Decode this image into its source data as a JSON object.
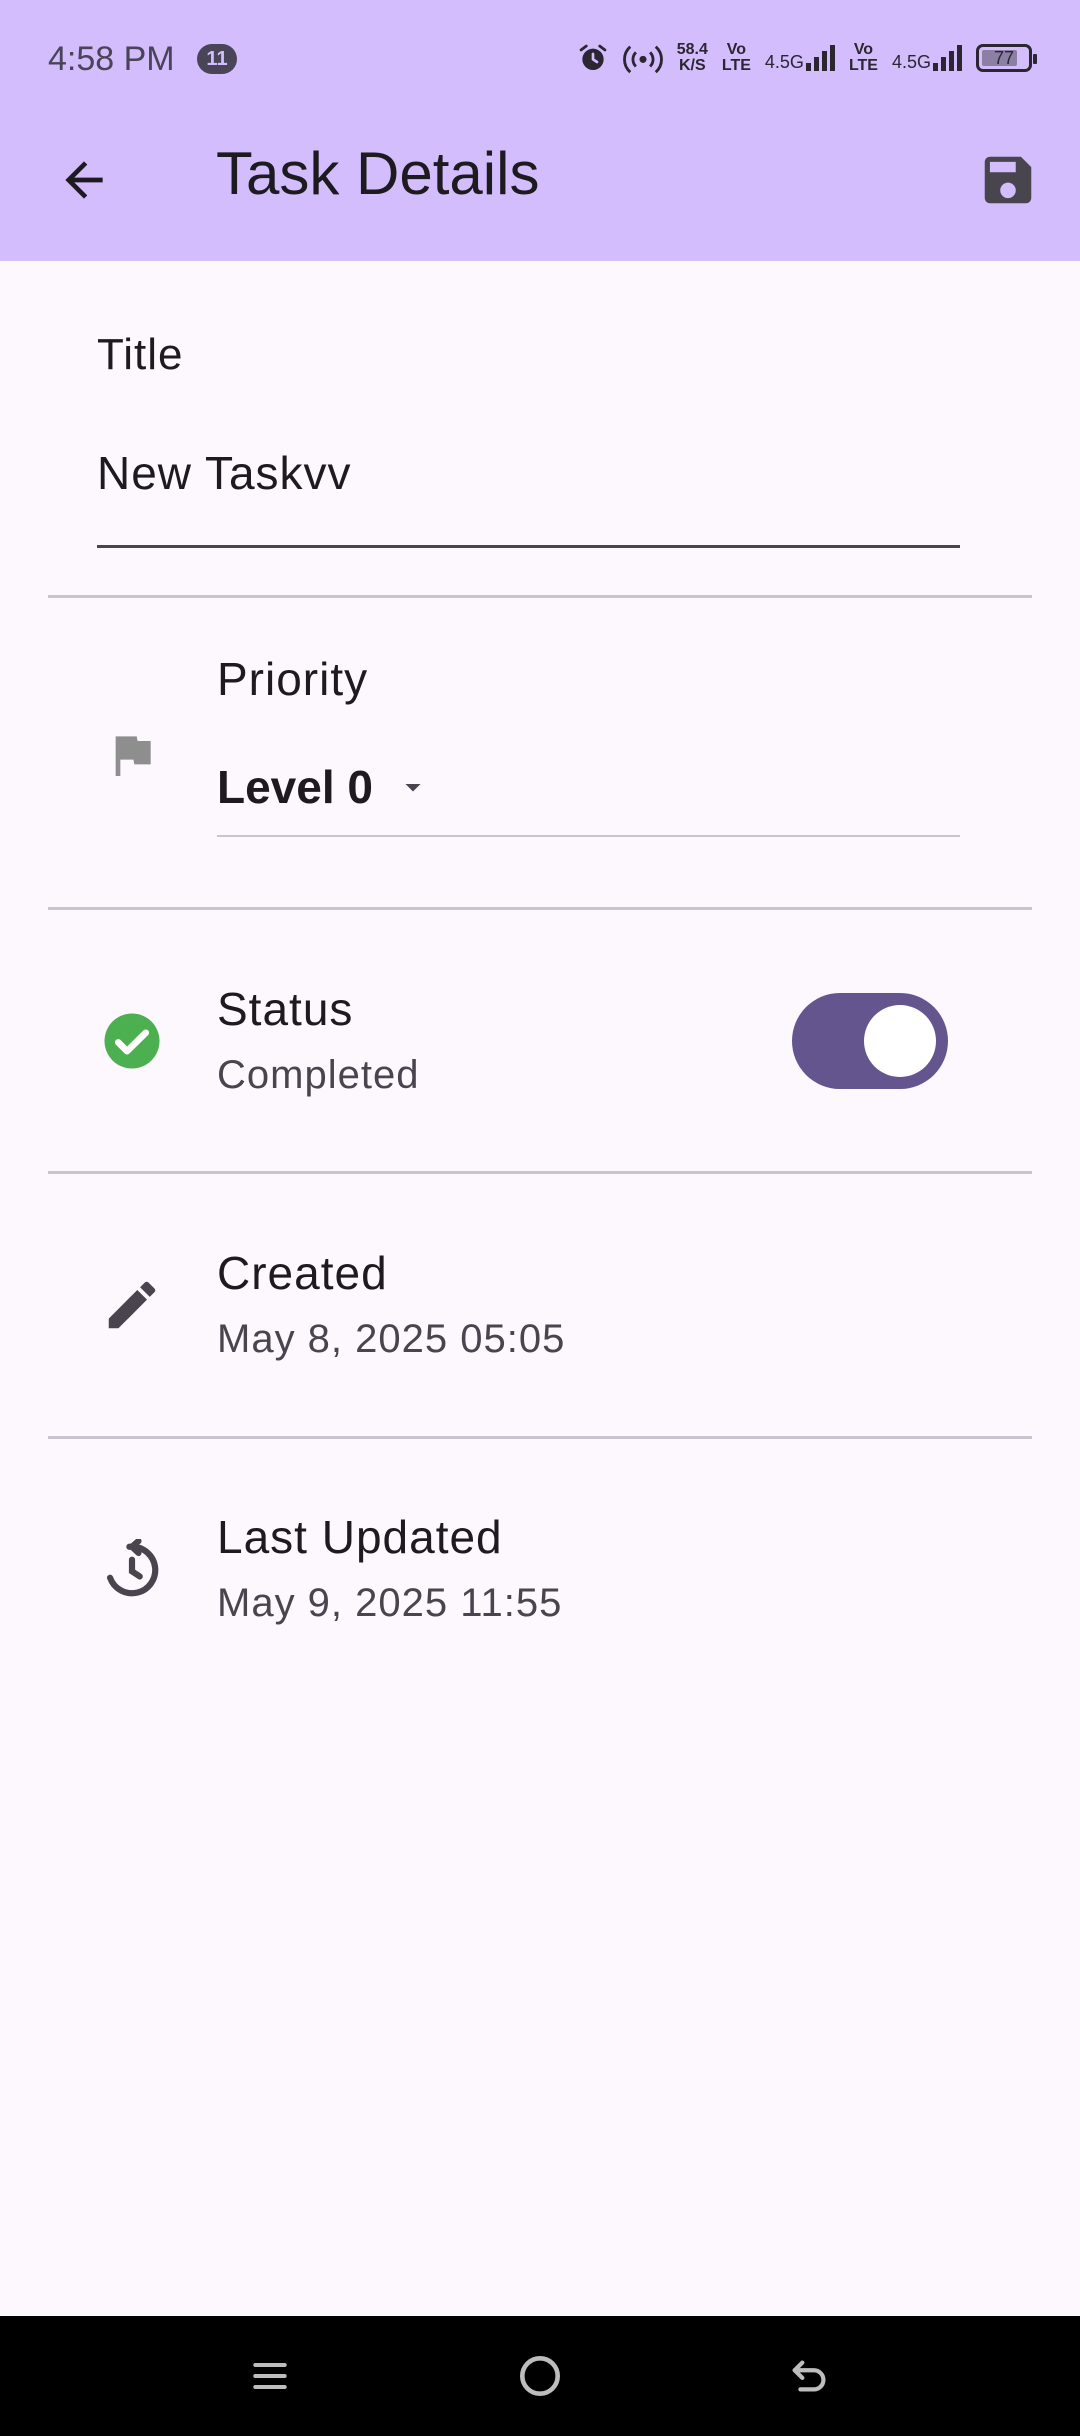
{
  "status_bar": {
    "time": "4:58 PM",
    "notification_count": "11",
    "net_speed_value": "58.4",
    "net_speed_unit": "K/S",
    "sim1_top": "Vo",
    "sim1_bottom": "LTE",
    "sim1_network": "4.5G",
    "sim2_top": "Vo",
    "sim2_bottom": "LTE",
    "sim2_network": "4.5G",
    "battery": "77"
  },
  "header": {
    "title": "Task Details",
    "back_icon": "arrow-back-icon",
    "save_icon": "save-floppy-icon",
    "background": "#d3bdfd"
  },
  "title_field": {
    "label": "Title",
    "value": "New Taskvv"
  },
  "priority": {
    "label": "Priority",
    "value": "Level 0",
    "icon": "flag-icon"
  },
  "status": {
    "label": "Status",
    "value": "Completed",
    "enabled": true,
    "icon": "check-circle-icon",
    "icon_color": "#4caf50",
    "switch_color": "#65558f"
  },
  "created": {
    "label": "Created",
    "value": "May 8, 2025 05:05",
    "icon": "pencil-icon"
  },
  "updated": {
    "label": "Last Updated",
    "value": "May 9, 2025 11:55",
    "icon": "history-icon"
  },
  "nav_bar": {
    "menu_icon": "menu-icon",
    "home_icon": "home-circle-icon",
    "back_icon": "back-gesture-icon"
  }
}
